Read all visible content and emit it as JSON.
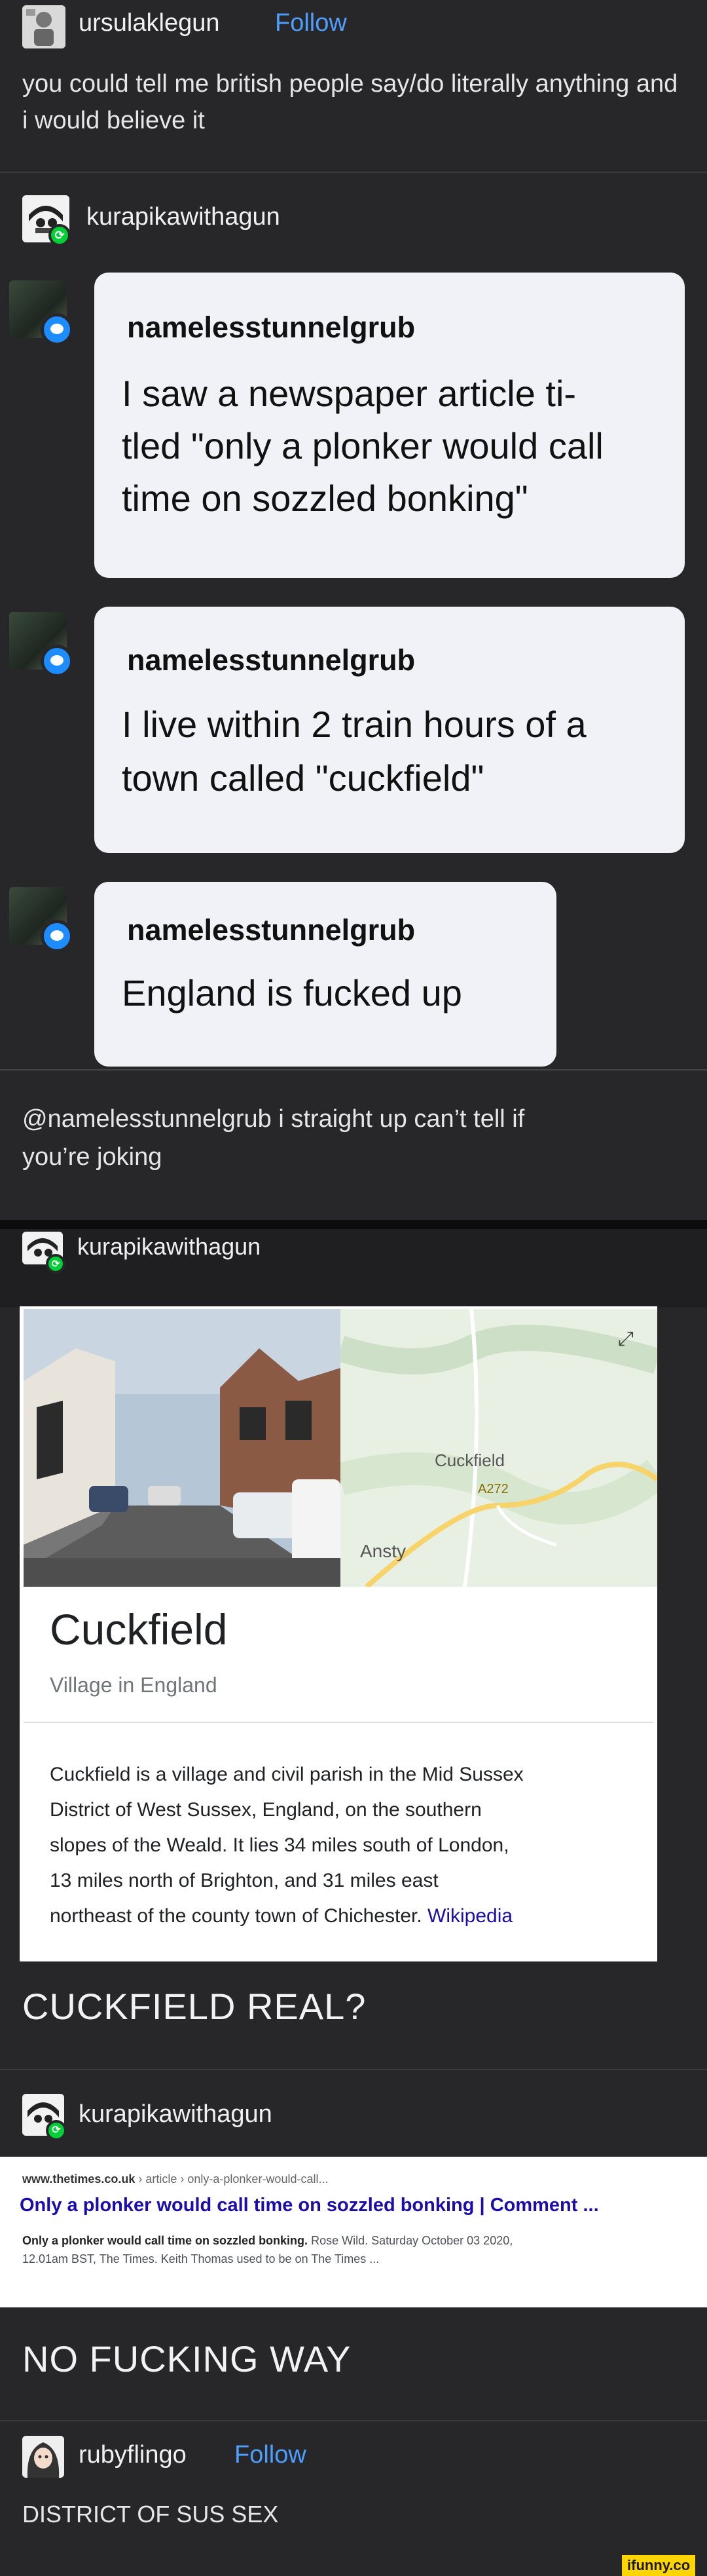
{
  "post1": {
    "username": "ursulaklegun",
    "follow_label": "Follow",
    "text": "you could tell me british people say/do literally anything and i would believe it"
  },
  "reblog1": {
    "username": "kurapikawithagun"
  },
  "bubbles": [
    {
      "name": "namelesstunnelgrub",
      "lines": [
        "I saw a newspaper article ti-",
        "tled \"only a plonker would call",
        "time on sozzled bonking\""
      ]
    },
    {
      "name": "namelesstunnelgrub",
      "lines": [
        "I live within 2 train hours of a",
        "town called \"cuckfield\""
      ]
    },
    {
      "name": "namelesstunnelgrub",
      "lines": [
        "England is fucked up"
      ]
    }
  ],
  "reply1": {
    "lines": [
      "@namelesstunnelgrub i straight up can’t tell if",
      "you’re joking"
    ]
  },
  "reblog2": {
    "username": "kurapikawithagun"
  },
  "knowledge_card": {
    "map_label_town": "Cuckfield",
    "map_label_road": "A272",
    "map_label_other": "Ansty",
    "title": "Cuckfield",
    "subtitle": "Village in England",
    "description_lines": [
      "Cuckfield is a village and civil parish in the Mid Sussex",
      "District of West Sussex, England, on the southern",
      "slopes of the Weald. It lies 34 miles south of London,",
      "13 miles north of Brighton, and 31 miles east",
      "northeast of the county town of Chichester."
    ],
    "source_link": "Wikipedia"
  },
  "caption1": "CUCKFIELD REAL?",
  "reblog3": {
    "username": "kurapikawithagun"
  },
  "search_result": {
    "url_domain": "www.thetimes.co.uk",
    "url_path": " › article › only-a-plonker-would-call...",
    "title": "Only a plonker would call time on sozzled bonking | Comment ...",
    "snippet_bold": "Only a plonker would call time on sozzled bonking.",
    "snippet_rest": " Rose Wild. Saturday October 03 2020,",
    "snippet_line2": "12.01am BST, The Times. Keith Thomas used to be on The Times ..."
  },
  "caption2": "NO FUCKING WAY",
  "post_final": {
    "username": "rubyflingo",
    "follow_label": "Follow",
    "text": "DISTRICT OF SUS SEX"
  },
  "watermark": "ifunny.co",
  "colors": {
    "background": "#27272a",
    "follow": "#4d9fff",
    "bubble": "#f1f2f7",
    "link": "#1a0dab",
    "reblog": "#00cf35"
  }
}
